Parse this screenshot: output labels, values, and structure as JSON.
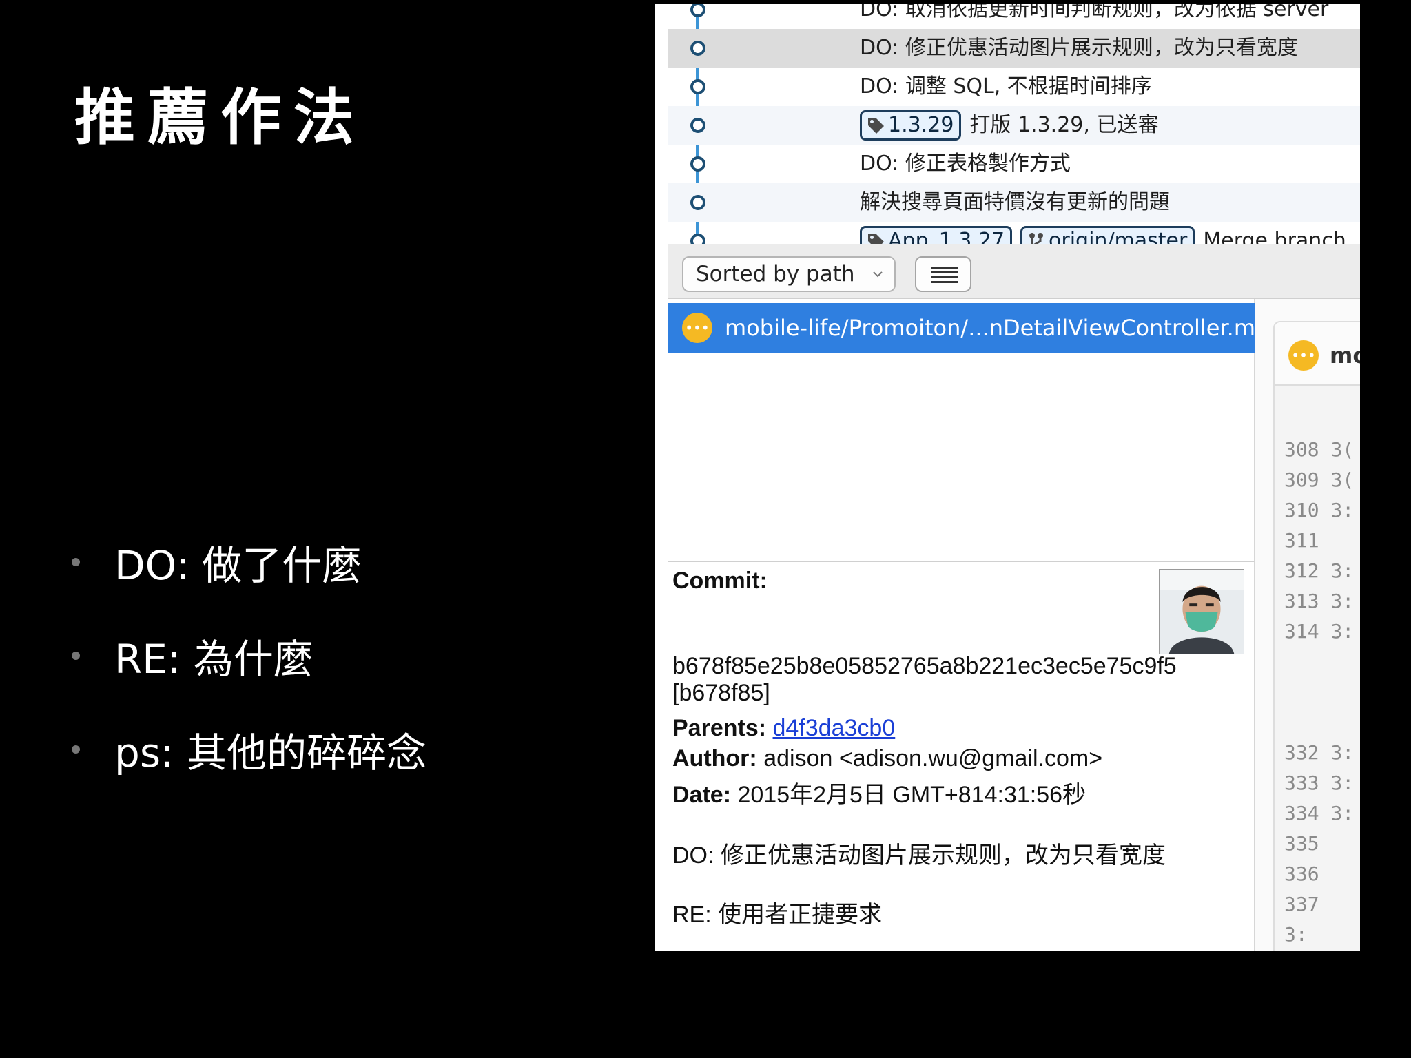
{
  "slide": {
    "title": "推薦作法",
    "bullets": [
      "DO: 做了什麼",
      "RE: 為什麼",
      "ps: 其他的碎碎念"
    ]
  },
  "history": {
    "rows": [
      {
        "tags": [],
        "message": "DO: 取消依据更新时间判断规则，改为依据 server"
      },
      {
        "tags": [],
        "message": "DO: 修正优惠活动图片展示规则，改为只看宽度"
      },
      {
        "tags": [],
        "message": "DO: 调整 SQL, 不根据时间排序"
      },
      {
        "tags": [
          "1.3.29"
        ],
        "message": "打版 1.3.29, 已送審"
      },
      {
        "tags": [],
        "message": "DO: 修正表格製作方式"
      },
      {
        "tags": [],
        "message": "解決搜尋頁面特價沒有更新的問題"
      },
      {
        "tags": [
          "App_1.3.27",
          "origin/master"
        ],
        "message": "Merge branch"
      }
    ]
  },
  "toolbar": {
    "sort_label": "Sorted by path"
  },
  "file_list": {
    "selected_file": "mobile-life/Promoiton/...nDetailViewController.m",
    "badge_glyph": "•••"
  },
  "commit": {
    "commit_label": "Commit:",
    "hash_full": "b678f85e25b8e05852765a8b221ec3ec5e75c9f5",
    "hash_short": "[b678f85]",
    "parents_label": "Parents:",
    "parents_value": "d4f3da3cb0",
    "author_label": "Author:",
    "author_value": "adison <adison.wu@gmail.com>",
    "date_label": "Date:",
    "date_value": "2015年2月5日 GMT+814:31:56秒",
    "message_do": "DO: 修正优惠活动图片展示规则，改为只看宽度",
    "message_re": "RE: 使用者正捷要求"
  },
  "diff": {
    "file_fragment": "mo",
    "lines": [
      {
        "n": "308",
        "m": "3("
      },
      {
        "n": "309",
        "m": "3("
      },
      {
        "n": "310",
        "m": "3:"
      },
      {
        "n": "311",
        "m": ""
      },
      {
        "n": "312",
        "m": "3:"
      },
      {
        "n": "313",
        "m": "3:"
      },
      {
        "n": "314",
        "m": "3:"
      },
      {
        "n": "332",
        "m": "3:"
      },
      {
        "n": "333",
        "m": "3:"
      },
      {
        "n": "334",
        "m": "3:"
      },
      {
        "n": "335",
        "m": ""
      },
      {
        "n": "336",
        "m": ""
      },
      {
        "n": "337",
        "m": ""
      },
      {
        "n": "",
        "m": "3:"
      }
    ]
  },
  "colors": {
    "graph_line": "#3d95d6",
    "selection": "#2f7fe0",
    "badge": "#f5b923",
    "link": "#1a3fd6"
  }
}
